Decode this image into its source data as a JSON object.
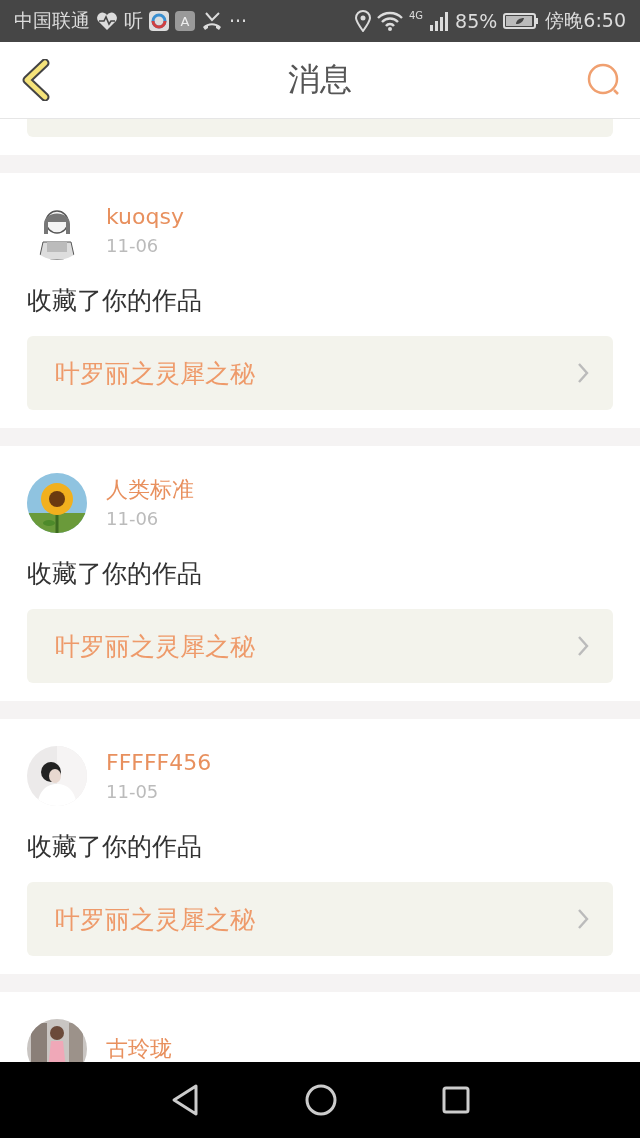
{
  "status_bar": {
    "carrier": "中国联通",
    "app_glyph": "听",
    "app_badge": "A",
    "more": "···",
    "network": "4G",
    "battery": "85%",
    "time": "傍晚6:50"
  },
  "header": {
    "title": "消息"
  },
  "messages": [
    {
      "user": "kuoqsy",
      "date": "11-06",
      "action": "收藏了你的作品",
      "work": "叶罗丽之灵犀之秘"
    },
    {
      "user": "人类标准",
      "date": "11-06",
      "action": "收藏了你的作品",
      "work": "叶罗丽之灵犀之秘"
    },
    {
      "user": "FFFFF456",
      "date": "11-05",
      "action": "收藏了你的作品",
      "work": "叶罗丽之灵犀之秘"
    },
    {
      "user": "古玲珑"
    }
  ]
}
